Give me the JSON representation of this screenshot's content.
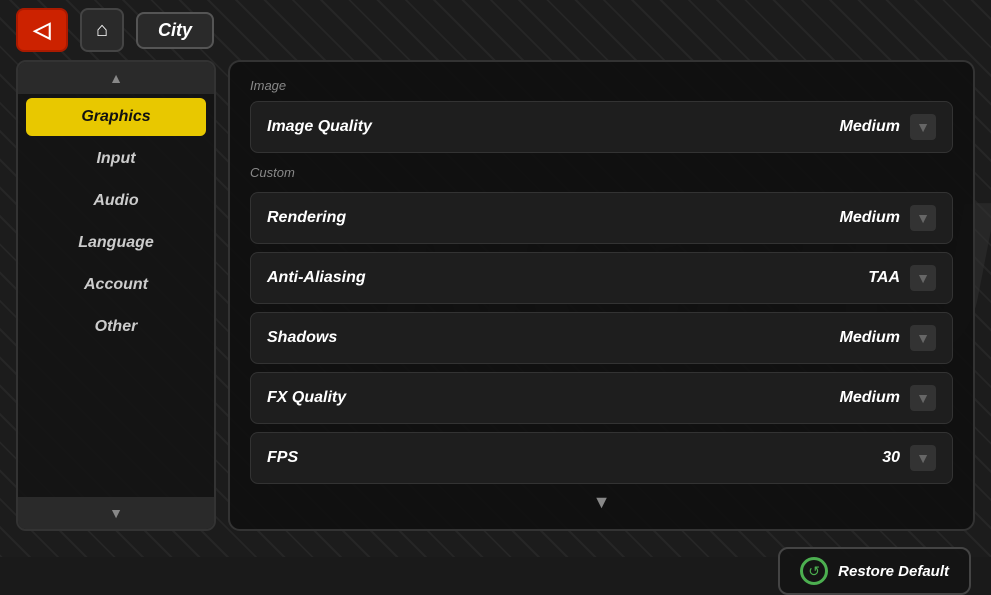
{
  "topbar": {
    "back_icon": "◁",
    "home_icon": "⌂",
    "location": "City"
  },
  "sidebar": {
    "scroll_up_arrow": "▲",
    "scroll_down_arrow": "▼",
    "items": [
      {
        "id": "graphics",
        "label": "Graphics",
        "active": true
      },
      {
        "id": "input",
        "label": "Input",
        "active": false
      },
      {
        "id": "audio",
        "label": "Audio",
        "active": false
      },
      {
        "id": "language",
        "label": "Language",
        "active": false
      },
      {
        "id": "account",
        "label": "Account",
        "active": false
      },
      {
        "id": "other",
        "label": "Other",
        "active": false
      }
    ]
  },
  "main": {
    "section_image": "Image",
    "section_custom": "Custom",
    "settings": [
      {
        "id": "image-quality",
        "label": "Image Quality",
        "value": "Medium",
        "section": "image"
      },
      {
        "id": "rendering",
        "label": "Rendering",
        "value": "Medium",
        "section": "custom"
      },
      {
        "id": "anti-aliasing",
        "label": "Anti-Aliasing",
        "value": "TAA",
        "section": "custom"
      },
      {
        "id": "shadows",
        "label": "Shadows",
        "value": "Medium",
        "section": "custom"
      },
      {
        "id": "fx-quality",
        "label": "FX Quality",
        "value": "Medium",
        "section": "custom"
      },
      {
        "id": "fps",
        "label": "FPS",
        "value": "30",
        "section": "custom"
      }
    ],
    "scroll_down_arrow": "▼",
    "dropdown_arrow": "▼"
  },
  "bottom": {
    "restore_icon": "↺",
    "restore_label": "Restore Default"
  }
}
